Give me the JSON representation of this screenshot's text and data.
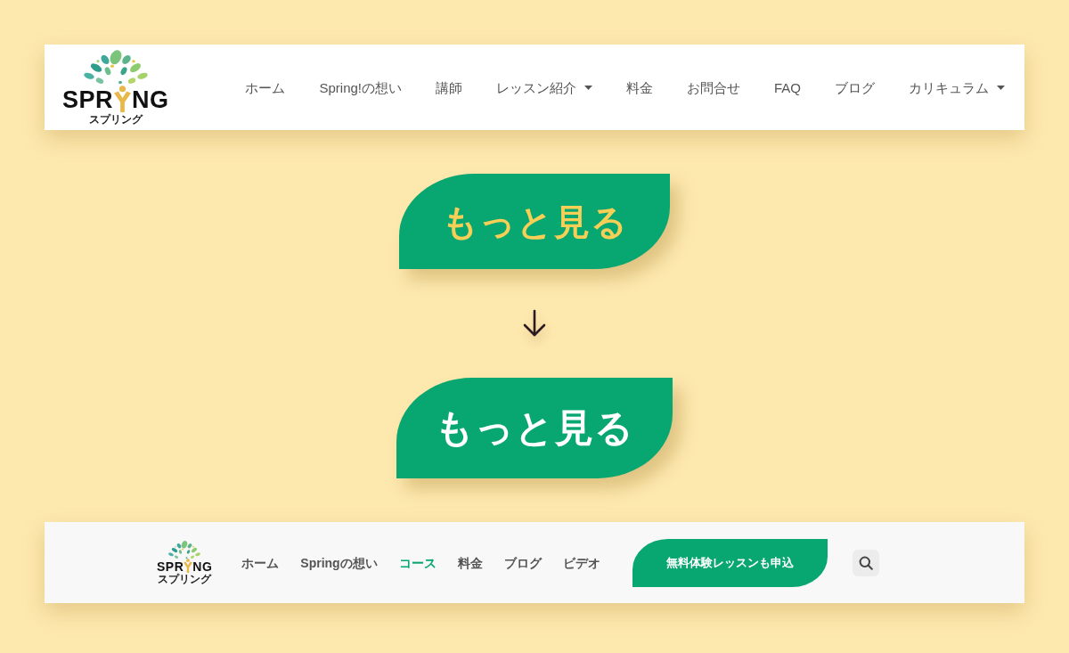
{
  "header": {
    "logo": {
      "wordmark_start": "SPR",
      "wordmark_end": "NG",
      "subtitle": "スプリング"
    },
    "nav": [
      {
        "label": "ホーム",
        "dropdown": false
      },
      {
        "label": "Spring!の想い",
        "dropdown": false
      },
      {
        "label": "講師",
        "dropdown": false
      },
      {
        "label": "レッスン紹介",
        "dropdown": true
      },
      {
        "label": "料金",
        "dropdown": false
      },
      {
        "label": "お問合せ",
        "dropdown": false
      },
      {
        "label": "FAQ",
        "dropdown": false
      },
      {
        "label": "ブログ",
        "dropdown": false
      },
      {
        "label": "カリキュラム",
        "dropdown": true
      }
    ]
  },
  "more_buttons": [
    {
      "label": "もっと見る",
      "kind": "accent"
    },
    {
      "label": "もっと見る",
      "kind": "plain"
    }
  ],
  "compact_header": {
    "logo": {
      "wordmark_start": "SPR",
      "wordmark_end": "NG",
      "subtitle": "スプリング"
    },
    "nav": [
      {
        "label": "ホーム",
        "selected": false
      },
      {
        "label": "Springの想い",
        "selected": false
      },
      {
        "label": "コース",
        "selected": true
      },
      {
        "label": "料金",
        "selected": false
      },
      {
        "label": "ブログ",
        "selected": false
      },
      {
        "label": "ビデオ",
        "selected": false
      }
    ],
    "cta": {
      "label": "無料体験レッスンも申込"
    }
  }
}
